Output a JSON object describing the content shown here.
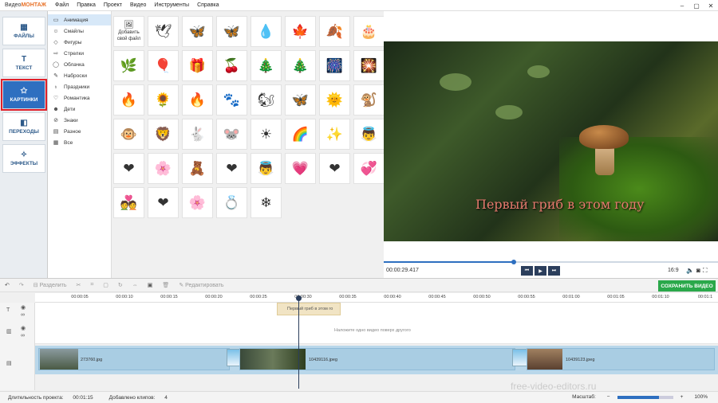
{
  "window": {
    "app_prefix": "Видео",
    "app_brand": "МОНТАЖ"
  },
  "menu": [
    "Файл",
    "Правка",
    "Проект",
    "Видео",
    "Инструменты",
    "Справка"
  ],
  "sidebar": [
    {
      "label": "ФАЙЛЫ",
      "icon": "files-icon"
    },
    {
      "label": "ТЕКСТ",
      "icon": "text-icon"
    },
    {
      "label": "КАРТИНКИ",
      "icon": "star-icon",
      "active": true
    },
    {
      "label": "ПЕРЕХОДЫ",
      "icon": "transitions-icon"
    },
    {
      "label": "ЭФФЕКТЫ",
      "icon": "magic-wand-icon"
    }
  ],
  "categories": [
    {
      "label": "Анимация",
      "selected": true
    },
    {
      "label": "Смайлы"
    },
    {
      "label": "Фигуры"
    },
    {
      "label": "Стрелки"
    },
    {
      "label": "Облачка"
    },
    {
      "label": "Наброски"
    },
    {
      "label": "Праздники"
    },
    {
      "label": "Романтика"
    },
    {
      "label": "Дети"
    },
    {
      "label": "Знаки"
    },
    {
      "label": "Разное"
    },
    {
      "label": "Все"
    }
  ],
  "gallery": {
    "add_label": "Добавить свой файл",
    "tiles": [
      "🕊",
      "🦋",
      "🦋",
      "💧",
      "🍁",
      "🍂",
      "🎂",
      "🌿",
      "🎈",
      "🎁",
      "🍒",
      "🎄",
      "🎄",
      "🎆",
      "🎇",
      "🔥",
      "🌻",
      "🔥",
      "🐾",
      "🐿",
      "🦋",
      "🌞",
      "🐒",
      "🐵",
      "🦁",
      "🐇",
      "🐭",
      "☀",
      "🌈",
      "✨",
      "👼",
      "❤",
      "🌸",
      "🧸",
      "❤",
      "👼",
      "💗",
      "❤",
      "💞",
      "💑",
      "❤",
      "🌸",
      "💍",
      "❄"
    ]
  },
  "preview": {
    "caption": "Первый гриб в этом году",
    "timecode": "00:00:29.417",
    "aspect": "16:9",
    "progress": 0.39
  },
  "toolbar": {
    "split": "Разделить",
    "edit": "Редактировать",
    "save": "СОХРАНИТЬ ВИДЕО"
  },
  "ruler": [
    "00:00:05",
    "00:00:10",
    "00:00:15",
    "00:00:20",
    "00:00:25",
    "00:00:30",
    "00:00:35",
    "00:00:40",
    "00:00:45",
    "00:00:50",
    "00:00:55",
    "00:01:00",
    "00:01:05",
    "00:01:10",
    "00:01:1"
  ],
  "timeline": {
    "text_clip": "Первый гриб в этом го",
    "overlay_hint": "Наложите одно видео поверх другого",
    "clips": [
      "273760.jpg",
      "10439116.jpeg",
      "10439123.jpeg"
    ]
  },
  "status": {
    "duration_label": "Длительность проекта:",
    "duration": "00:01:15",
    "clips_label": "Добавлено клипов:",
    "clips": "4",
    "zoom_label": "Масштаб:",
    "zoom": "100%"
  },
  "watermark": "free-video-editors.ru"
}
